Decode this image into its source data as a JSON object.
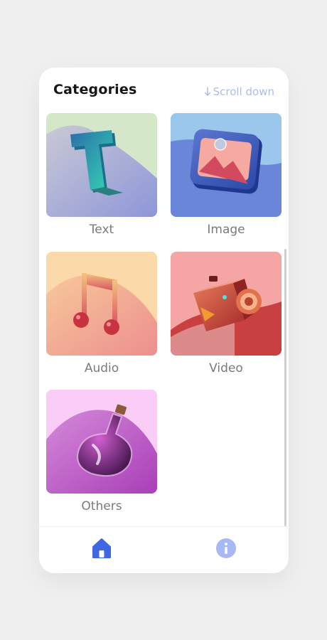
{
  "header": {
    "title": "Categories",
    "scroll_hint": "Scroll down"
  },
  "categories": [
    {
      "label": "Text",
      "icon": "letter-t-icon"
    },
    {
      "label": "Image",
      "icon": "image-icon"
    },
    {
      "label": "Audio",
      "icon": "music-note-icon"
    },
    {
      "label": "Video",
      "icon": "camera-icon"
    },
    {
      "label": "Others",
      "icon": "flask-icon"
    }
  ],
  "nav": {
    "items": [
      {
        "name": "home",
        "icon": "home-icon",
        "active": true
      },
      {
        "name": "info",
        "icon": "info-icon",
        "active": false
      }
    ]
  },
  "colors": {
    "accent": "#3f67e0",
    "muted_accent": "#aebde8",
    "info_icon": "#a8b8f4"
  }
}
